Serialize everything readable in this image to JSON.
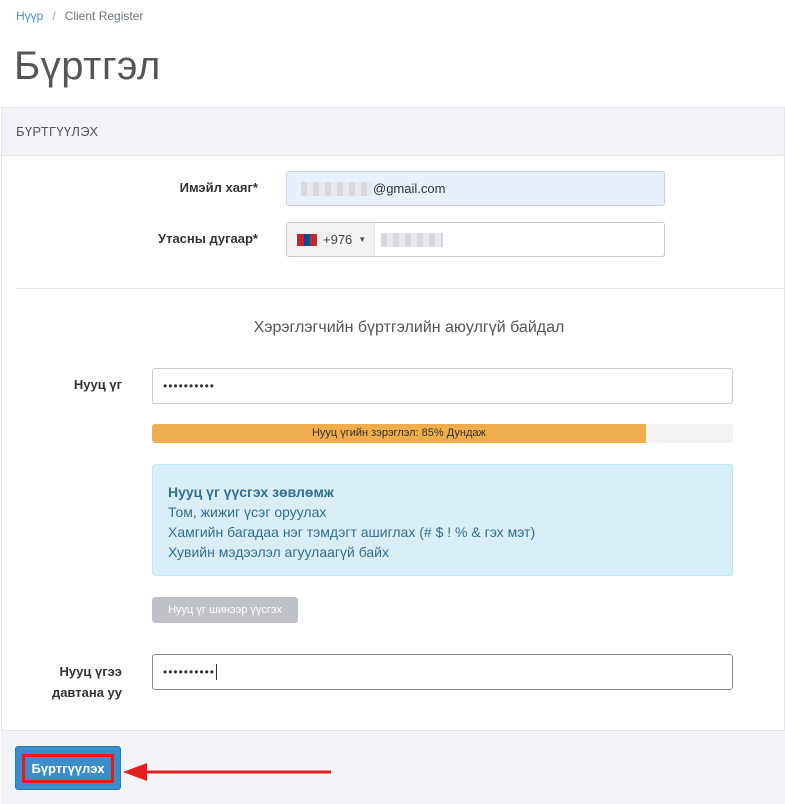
{
  "breadcrumb": {
    "home": "Нүүр",
    "current": "Client Register"
  },
  "page_title": "Бүртгэл",
  "panel": {
    "heading": "БҮРТГҮҮЛЭХ"
  },
  "form": {
    "email_label": "Имэйл хаяг*",
    "email_value_suffix": "@gmail.com",
    "phone_label": "Утасны дугаар*",
    "phone_code": "+976",
    "security_title": "Хэрэглэгчийн бүртгэлийн аюулгүй байдал",
    "password_label": "Нууц үг",
    "password_value": "••••••••••",
    "strength_text": "Нууц үгийн зэрэглэл: 85% Дундаж",
    "strength_percent": 85,
    "tips": {
      "title": "Нууц үг үүсгэх зөвлөмж",
      "line1": "Том, жижиг үсэг оруулах",
      "line2": "Хамгийн багадаа нэг тэмдэгт ашиглах (# $ ! % & гэх мэт)",
      "line3": "Хувийн мэдээлэл агуулаагүй байх"
    },
    "generate_button": "Нууц үг шинээр үүсгэх",
    "confirm_label_line1": "Нууц үгээ",
    "confirm_label_line2": "давтана уу",
    "confirm_value": "••••••••••"
  },
  "submit_button": "Бүртгүүлэх",
  "colors": {
    "accent": "#3c8dcb",
    "highlight": "#e51d1d",
    "warning": "#f0ad4e"
  },
  "icons": {
    "flag": "mongolia-flag-icon",
    "caret": "caret-down-icon",
    "arrow": "left-arrow-annotation"
  }
}
